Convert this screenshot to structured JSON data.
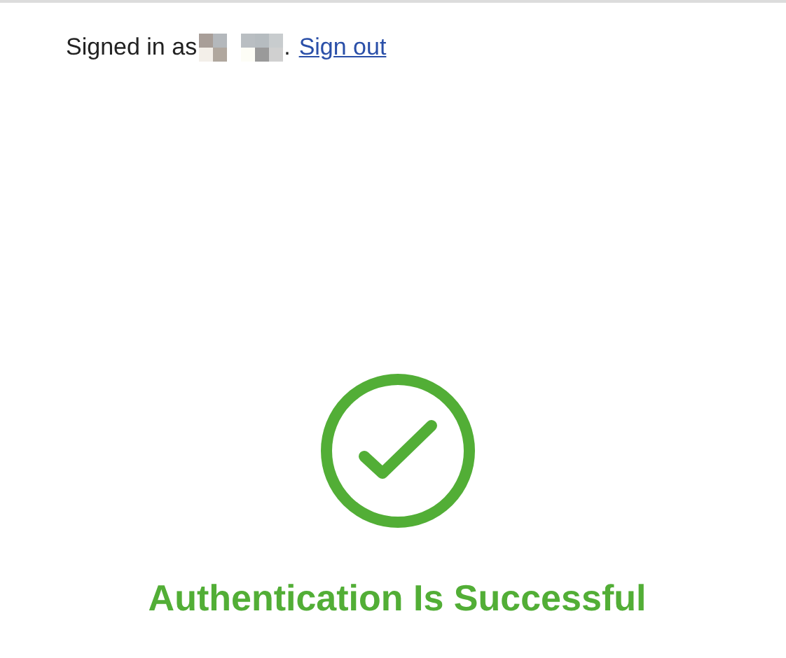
{
  "account": {
    "prefix": "Signed in as",
    "suffix": ".",
    "link": "Sign out"
  },
  "result": {
    "succeeded": true,
    "title": "Authentication Is Successful"
  }
}
